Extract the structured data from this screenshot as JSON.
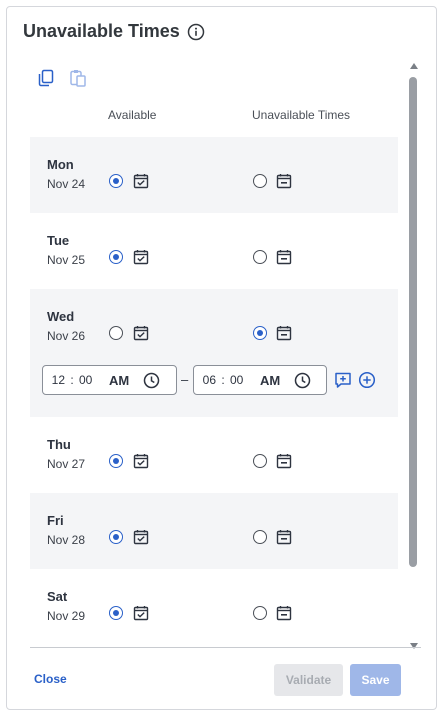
{
  "dialog": {
    "title": "Unavailable Times"
  },
  "columns": {
    "available": "Available",
    "unavailable": "Unavailable Times"
  },
  "days": [
    {
      "day": "Mon",
      "date": "Nov 24",
      "selected": "available"
    },
    {
      "day": "Tue",
      "date": "Nov 25",
      "selected": "available"
    },
    {
      "day": "Wed",
      "date": "Nov 26",
      "selected": "unavailable"
    },
    {
      "day": "Thu",
      "date": "Nov 27",
      "selected": "available"
    },
    {
      "day": "Fri",
      "date": "Nov 28",
      "selected": "available"
    },
    {
      "day": "Sat",
      "date": "Nov 29",
      "selected": "available"
    }
  ],
  "time_range": {
    "start": {
      "hour": "12",
      "minute": "00",
      "ampm": "AM"
    },
    "separator": "–",
    "end": {
      "hour": "06",
      "minute": "00",
      "ampm": "AM"
    }
  },
  "footer": {
    "close_label": "Close",
    "validate_label": "Validate",
    "save_label": "Save"
  },
  "colors": {
    "accent": "#2a60c8",
    "row_shade": "#f4f5f7",
    "save_disabled": "#9fb7e8"
  },
  "icons": {
    "info": "info-icon",
    "copy": "copy-icon",
    "paste": "paste-icon",
    "calendar_check": "calendar-check-icon",
    "calendar_minus": "calendar-minus-icon",
    "clock": "clock-icon",
    "add_comment": "add-comment-icon",
    "add_circle": "add-circle-icon"
  }
}
